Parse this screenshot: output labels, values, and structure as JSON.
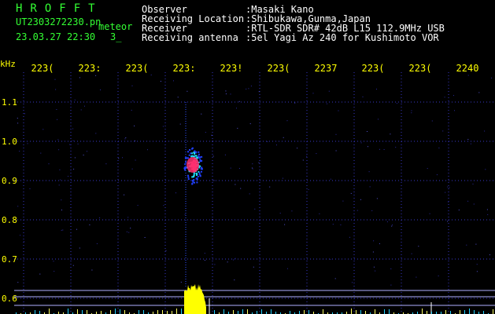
{
  "app": {
    "name": "HROFFT",
    "file_name": "UT2303272230.pn",
    "file_suffix": "meteor",
    "timestamp": "23.03.27 22:30",
    "count": "3_"
  },
  "info": {
    "labels": [
      "Observer",
      "Receiving Location",
      "Receiver",
      "Receiving antenna"
    ],
    "values": [
      ":Masaki Kano",
      ":Shibukawa,Gunma,Japan",
      ":RTL-SDR SDR# 42dB L15 112.9MHz USB",
      ":5el Yagi Az 240 for Kushimoto VOR"
    ]
  },
  "axis": {
    "y_unit": "kHz",
    "y_ticks": [
      "1.1",
      "1.0",
      "0.9",
      "0.8",
      "0.7",
      "0.6"
    ],
    "x_ticks": [
      "223(",
      "223:",
      "223(",
      "223:",
      "223!",
      "223(",
      "2237",
      "223(",
      "223(",
      "2240"
    ]
  },
  "colors": {
    "grid": "#3838c8",
    "tick_text": "#ffff00",
    "label_text": "#33ff33",
    "info_text": "#ffffff",
    "spectrum_fill": "#ffff00",
    "echo_core": "#ff3070",
    "echo_halo": "#20e0ff"
  },
  "echo": {
    "description_free_value_ghz_offset_khz": 0.93
  }
}
